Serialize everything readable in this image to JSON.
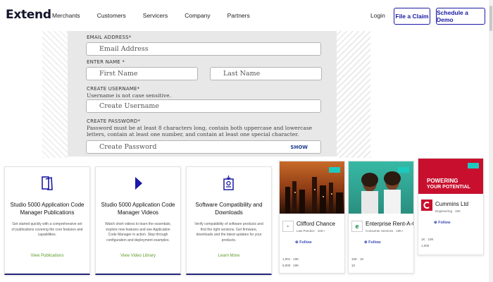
{
  "header": {
    "logo": "Extend",
    "nav": [
      "Merchants",
      "Customers",
      "Servicers",
      "Company",
      "Partners"
    ],
    "login": "Login",
    "claim_button": "File a Claim",
    "demo_button": "Schedule a Demo"
  },
  "form": {
    "email_label": "EMAIL ADDRESS*",
    "email_placeholder": "Email Address",
    "name_label": "ENTER NAME *",
    "first_placeholder": "First Name",
    "last_placeholder": "Last Name",
    "username_label": "CREATE USERNAME*",
    "username_help": "Username is not case sensitive.",
    "username_placeholder": "Create Username",
    "password_label": "CREATE PASSWORD*",
    "password_help": "Password must be at least 8 characters long, contain both uppercase and lowercase letters, contain at least one number, and contain at least one special character.",
    "password_placeholder": "Create Password",
    "show_label": "SHOW"
  },
  "cards": [
    {
      "icon": "document-icon",
      "title": "Studio 5000 Application Code Manager Publications",
      "desc": "Get started quickly with a comprehensive set of publications covering the core features and capabilities.",
      "link": "View Publications"
    },
    {
      "icon": "play-icon",
      "title": "Studio 5000 Application Code Manager Videos",
      "desc": "Watch short videos to learn the essentials, explore new features and see Application Code Manager in action. Step through configuration and deployment examples.",
      "link": "View Video Library"
    },
    {
      "icon": "download-icon",
      "title": "Software Compatibility and Downloads",
      "desc": "Verify compatibility of software products and find the right versions. Get firmware, downloads and the latest updates for your products.",
      "link": "Learn More"
    }
  ],
  "profiles": [
    {
      "name": "Clifford Chance",
      "sub": "Law Practice · 10K+",
      "follow": "Follow",
      "stat1": "1,001 · 10K",
      "stat2": "5,000 · 10K"
    },
    {
      "name": "Enterprise Rent-A-Car",
      "sub": "Consumer Services · 10K+",
      "follow": "Follow",
      "stat1": "10K · 1K",
      "stat2": "10"
    },
    {
      "name": "Cummins Ltd",
      "sub": "Engineering · 10K",
      "follow": "Follow",
      "stat1": "1K · 10K",
      "stat2": "1,000",
      "banner_line1": "POWERING",
      "banner_line2": "YOUR POTENTIAL"
    }
  ],
  "colors": {
    "brand_blue": "#1a1aa6",
    "link_green": "#5c9c2a",
    "follow_blue": "#3b4bb5",
    "tag_teal": "#1ec9c0"
  }
}
